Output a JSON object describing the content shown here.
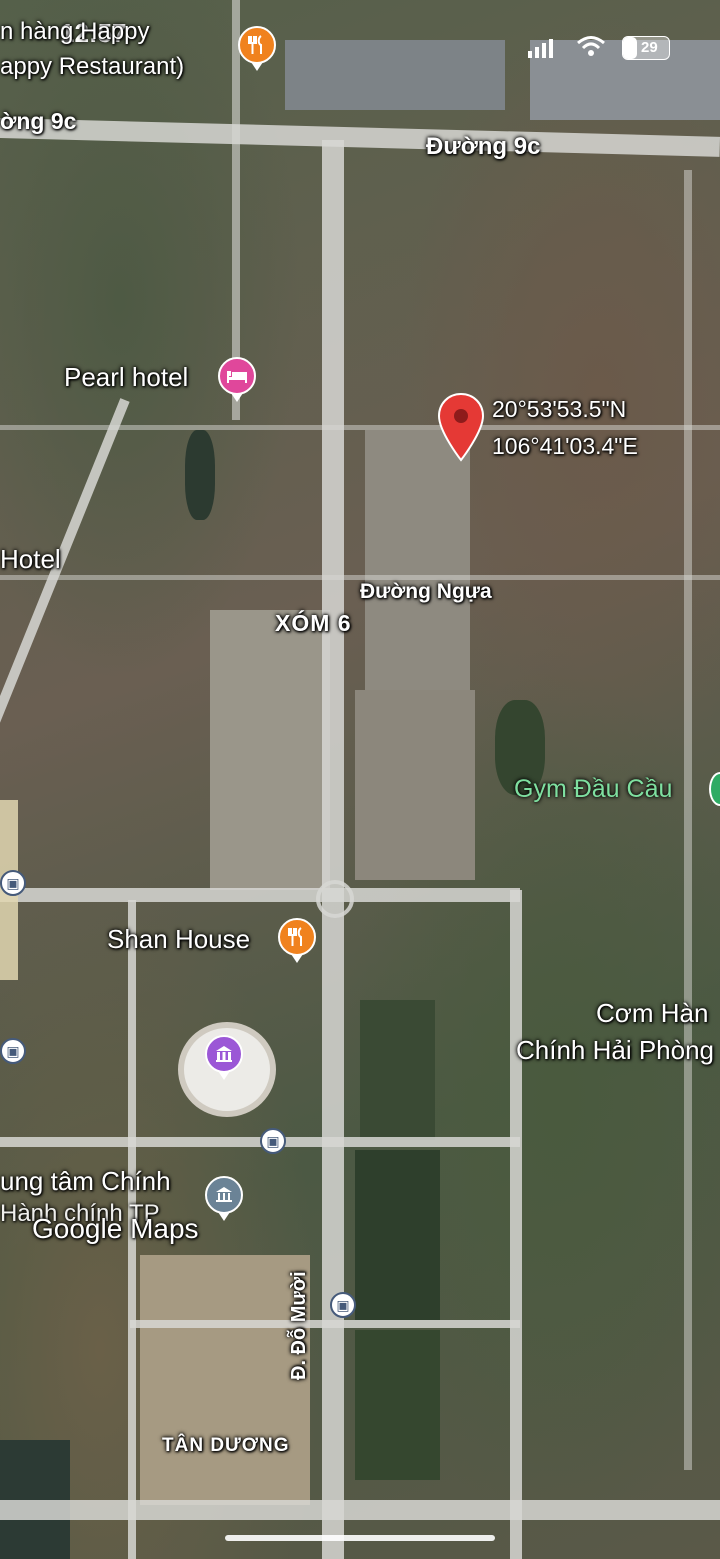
{
  "status_bar": {
    "time": "12:57",
    "battery": "29"
  },
  "watermark": "Google Maps",
  "dropped_pin": {
    "lat": "20°53'53.5\"N",
    "lng": "106°41'03.4\"E"
  },
  "road_labels": {
    "duong_9c_left": "ờng 9c",
    "duong_9c_right": "Đường 9c",
    "duong_ngua": "Đường Ngựa",
    "do_muoi": "Đ. Đỗ Mười"
  },
  "area_labels": {
    "xom6": "XÓM 6",
    "tan_duong": "TÂN DƯƠNG"
  },
  "places": {
    "happy_restaurant_line1": "n hàng Happy",
    "happy_restaurant_line2": "appy Restaurant)",
    "pearl_hotel": "Pearl hotel",
    "hotel": "Hotel",
    "gym": "Gym Đầu Cầu",
    "shan_house": "Shan House",
    "com_line1": "Cơm Hàn",
    "com_line2": "Chính Hải Phòng",
    "trung_tam_line1": "ung tâm Chính",
    "trung_tam_line2": "Hành chính TP"
  },
  "icons": {
    "restaurant": "restaurant-icon",
    "hotel": "hotel-icon",
    "landmark": "landmark-icon",
    "government": "government-icon",
    "bus": "bus-stop-icon",
    "pin": "location-pin-icon"
  },
  "colors": {
    "restaurant": "#f0821e",
    "hotel": "#e0479b",
    "landmark": "#9b57d6",
    "government": "#6b8396",
    "pin": "#e53935",
    "gym_text": "#7fe0a0"
  }
}
